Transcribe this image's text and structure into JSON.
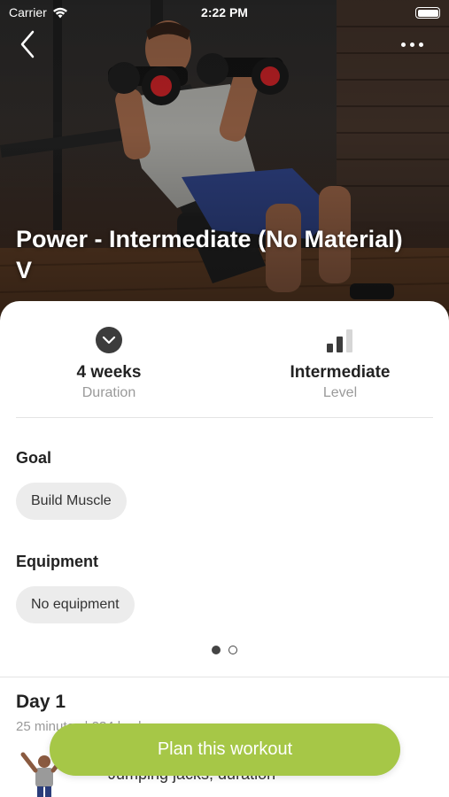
{
  "status_bar": {
    "carrier": "Carrier",
    "time": "2:22 PM"
  },
  "hero": {
    "title": "Power - Intermediate (No Material) V",
    "back_icon": "chevron-left-icon",
    "more_icon": "more-horizontal-icon"
  },
  "stats": {
    "duration": {
      "value": "4 weeks",
      "caption": "Duration",
      "icon": "chevron-down-circle-icon"
    },
    "level": {
      "value": "Intermediate",
      "caption": "Level",
      "icon": "level-bars-icon"
    }
  },
  "goal": {
    "label": "Goal",
    "chip": "Build Muscle"
  },
  "equipment": {
    "label": "Equipment",
    "chip": "No equipment"
  },
  "pager": {
    "count": 2,
    "active": 1
  },
  "day": {
    "title": "Day 1",
    "meta": "25 minutes | 234 kcal",
    "exercise": "Jumping jacks, duration"
  },
  "cta": {
    "label": "Plan this workout",
    "color": "#a6c747"
  }
}
